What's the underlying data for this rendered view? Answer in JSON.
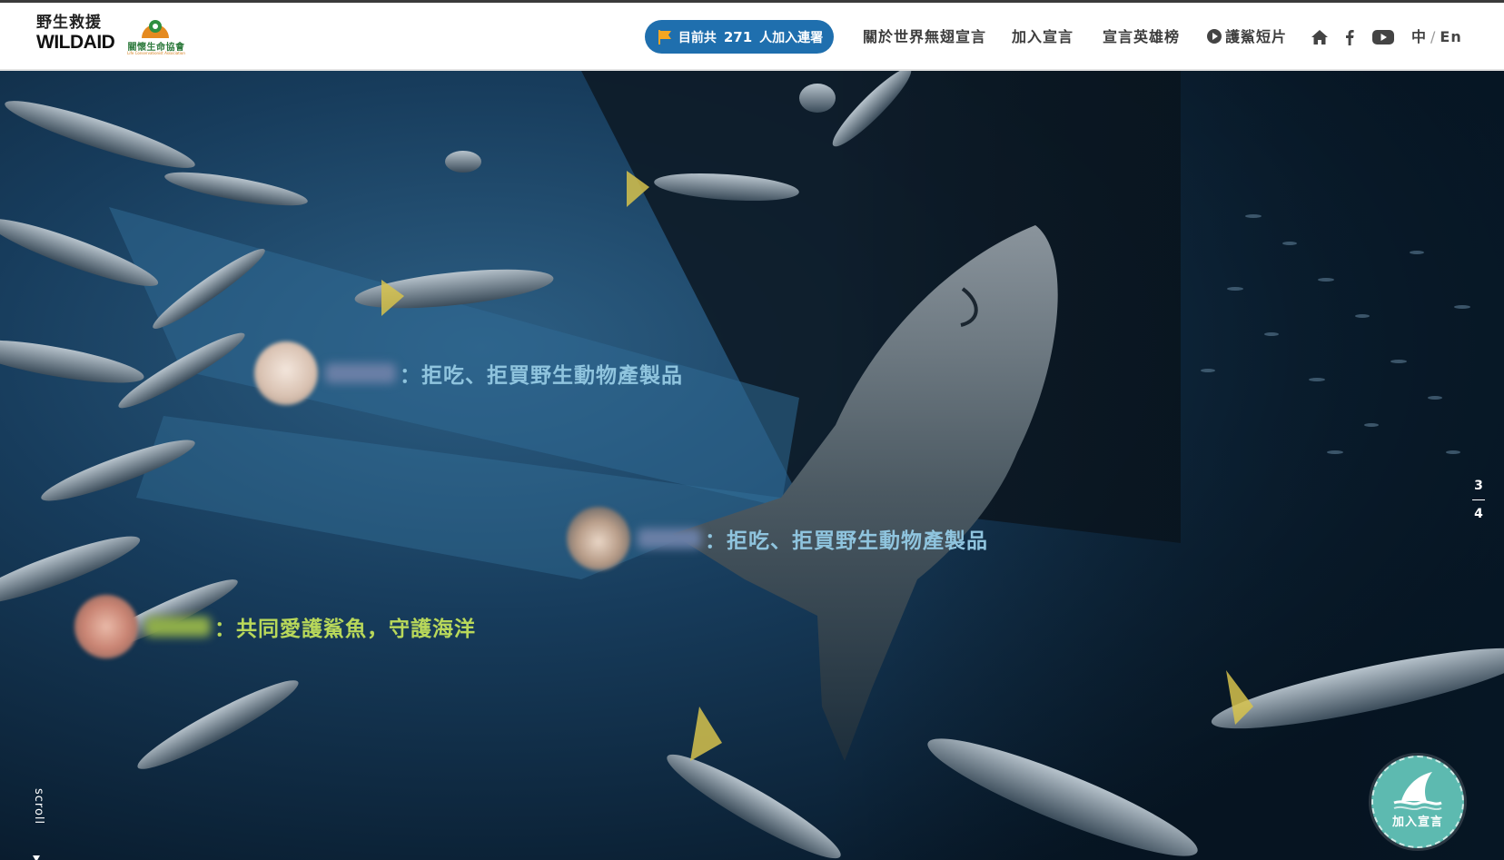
{
  "header": {
    "logo_wildaid_cn": "野生救援",
    "logo_wildaid_en": "WILDAID",
    "logo_lca_name": "關懷生命協會",
    "logo_lca_sub": "Life Conservationist Association",
    "counter": {
      "prefix": "目前共",
      "count": "271",
      "suffix": "人加入連署"
    },
    "nav": [
      {
        "label": "關於世界無翅宣言",
        "active": false
      },
      {
        "label": "加入宣言",
        "active": true
      },
      {
        "label": "宣言英雄榜",
        "active": false
      },
      {
        "label": "護鯊短片",
        "active": false,
        "icon": "play-icon"
      }
    ],
    "icons": [
      "home-icon",
      "facebook-icon",
      "youtube-icon"
    ],
    "lang": {
      "zh": "中",
      "sep": "/",
      "en": "En"
    }
  },
  "hero": {
    "pledges": [
      {
        "text": "：拒吃、拒買野生動物產製品",
        "color": "#8fc4de"
      },
      {
        "text": "：拒吃、拒買野生動物產製品",
        "color": "#8fc4de"
      },
      {
        "text": "：共同愛護鯊魚，守護海洋",
        "color": "#b9d85a"
      }
    ],
    "pager": {
      "current": "3",
      "total": "4"
    },
    "scroll_label": "scroll",
    "join_button_label": "加入宣言"
  },
  "colors": {
    "accent_teal": "#6bc7c0",
    "counter_blue": "#1f6fae",
    "fab_teal": "#5dbab0"
  }
}
